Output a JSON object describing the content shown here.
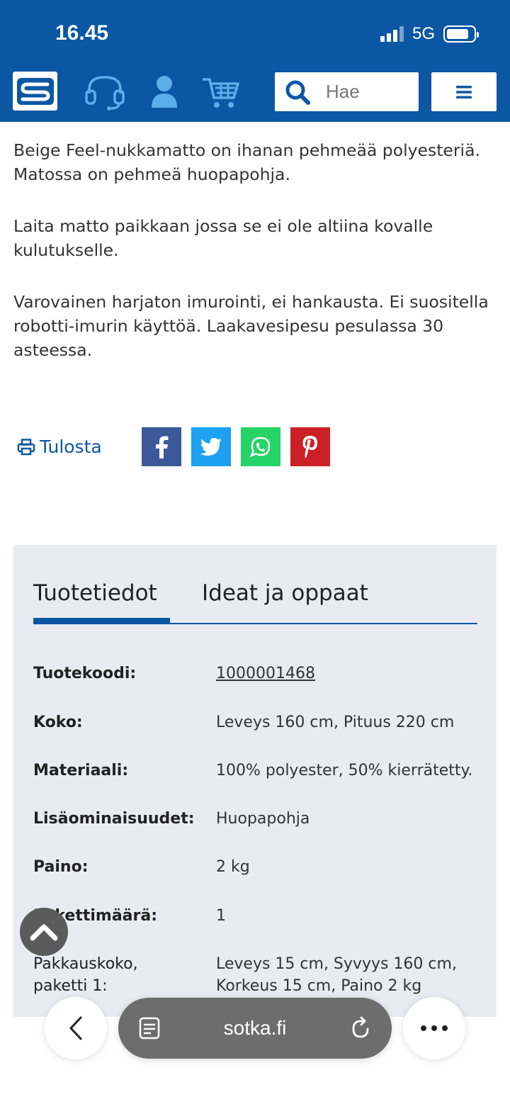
{
  "status_bar": {
    "time": "16.45",
    "network": "5G"
  },
  "header": {
    "logo_letter": "S",
    "search_placeholder": "Hae",
    "icons": [
      "headset-icon",
      "user-icon",
      "cart-icon",
      "search-icon",
      "menu-icon"
    ],
    "brand_color": "#0b57a3"
  },
  "description": {
    "paragraphs": [
      "Beige Feel-nukkamatto on ihanan pehmeää polyesteriä. Matossa on pehmeä huopapohja.",
      "Laita matto paikkaan jossa se ei ole altiina kovalle kulutukselle.",
      "Varovainen harjaton imurointi, ei hankausta. Ei suositella robotti-imurin käyttöä. Laakavesipesu pesulassa 30 asteessa."
    ]
  },
  "share": {
    "print_label": "Tulosta",
    "networks": [
      {
        "name": "facebook",
        "color": "#3b5998"
      },
      {
        "name": "twitter",
        "color": "#1da1f2"
      },
      {
        "name": "whatsapp",
        "color": "#25d366"
      },
      {
        "name": "pinterest",
        "color": "#cb2027"
      }
    ]
  },
  "product_info": {
    "tabs": [
      {
        "label": "Tuotetiedot",
        "active": true
      },
      {
        "label": "Ideat ja oppaat",
        "active": false
      }
    ],
    "specs": [
      {
        "label": "Tuotekoodi:",
        "value": "1000001468"
      },
      {
        "label": "Koko:",
        "value": "Leveys 160 cm, Pituus 220 cm"
      },
      {
        "label": "Materiaali:",
        "value": "100% polyester, 50% kierrätetty."
      },
      {
        "label": "Lisäominaisuudet:",
        "value": "Huopapohja"
      },
      {
        "label": "Paino:",
        "value": "2 kg"
      },
      {
        "label": "Pakettimäärä:",
        "value": "1"
      },
      {
        "label": "Pakkauskoko, paketti 1:",
        "value": "Leveys 15 cm, Syvyys 160 cm, Korkeus 15 cm, Paino 2 kg"
      }
    ]
  },
  "browser": {
    "url": "sotka.fi"
  }
}
